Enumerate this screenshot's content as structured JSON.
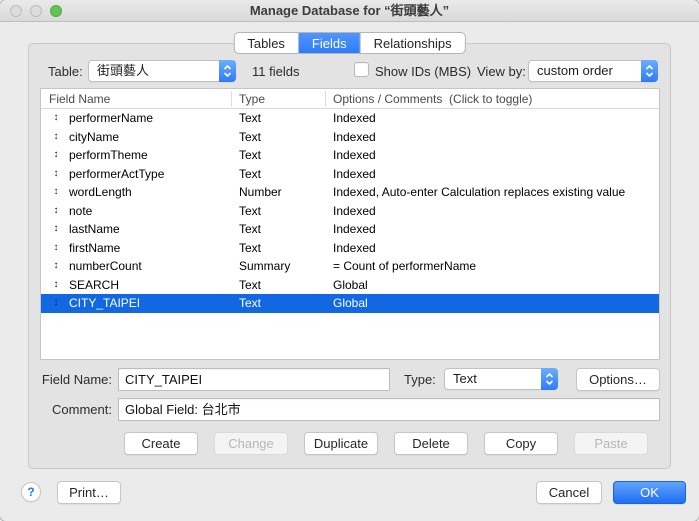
{
  "window": {
    "title": "Manage Database for “街頭藝人”"
  },
  "tabs": [
    {
      "label": "Tables",
      "active": false
    },
    {
      "label": "Fields",
      "active": true
    },
    {
      "label": "Relationships",
      "active": false
    }
  ],
  "toolbar": {
    "table_label": "Table:",
    "table_value": "街頭藝人",
    "fields_count": "11 fields",
    "show_ids_label": "Show IDs (MBS)",
    "show_ids_checked": false,
    "view_by_label": "View by:",
    "view_by_value": "custom order"
  },
  "field_list": {
    "columns": [
      "Field Name",
      "Type",
      "Options / Comments  (Click to toggle)"
    ],
    "drag_glyph": "↕",
    "rows": [
      {
        "name": "performerName",
        "type": "Text",
        "options": "Indexed",
        "selected": false
      },
      {
        "name": "cityName",
        "type": "Text",
        "options": "Indexed",
        "selected": false
      },
      {
        "name": "performTheme",
        "type": "Text",
        "options": "Indexed",
        "selected": false
      },
      {
        "name": "performerActType",
        "type": "Text",
        "options": "Indexed",
        "selected": false
      },
      {
        "name": "wordLength",
        "type": "Number",
        "options": "Indexed, Auto-enter Calculation replaces existing value",
        "selected": false
      },
      {
        "name": "note",
        "type": "Text",
        "options": "Indexed",
        "selected": false
      },
      {
        "name": "lastName",
        "type": "Text",
        "options": "Indexed",
        "selected": false
      },
      {
        "name": "firstName",
        "type": "Text",
        "options": "Indexed",
        "selected": false
      },
      {
        "name": "numberCount",
        "type": "Summary",
        "options": "= Count of performerName",
        "selected": false
      },
      {
        "name": "SEARCH",
        "type": "Text",
        "options": "Global",
        "selected": false
      },
      {
        "name": "CITY_TAIPEI",
        "type": "Text",
        "options": "Global",
        "selected": true
      }
    ]
  },
  "editor": {
    "field_name_label": "Field Name:",
    "field_name_value": "CITY_TAIPEI",
    "type_label": "Type:",
    "type_value": "Text",
    "options_button": "Options…",
    "comment_label": "Comment:",
    "comment_value": "Global Field: 台北市"
  },
  "actions": [
    {
      "label": "Create",
      "enabled": true
    },
    {
      "label": "Change",
      "enabled": false
    },
    {
      "label": "Duplicate",
      "enabled": true
    },
    {
      "label": "Delete",
      "enabled": true
    },
    {
      "label": "Copy",
      "enabled": true
    },
    {
      "label": "Paste",
      "enabled": false
    }
  ],
  "footer": {
    "help_label": "?",
    "print_button": "Print…",
    "cancel_button": "Cancel",
    "ok_button": "OK"
  },
  "colors": {
    "accent_blue": "#3b86fb",
    "selection_blue": "#1268e3",
    "ok_top": "#60a4fa",
    "ok_bottom": "#1f6ef5",
    "traffic_green": "#61c554"
  }
}
